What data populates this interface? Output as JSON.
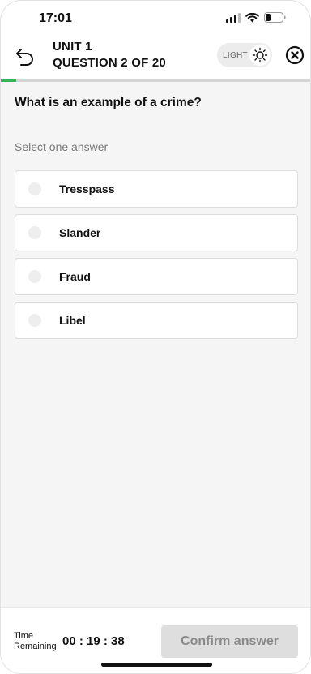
{
  "status": {
    "time": "17:01"
  },
  "header": {
    "unit": "UNIT 1",
    "question_count": "QUESTION 2 OF 20",
    "theme_label": "LIGHT"
  },
  "progress": {
    "fraction": 0.05
  },
  "question": {
    "text": "What is an example of a crime?",
    "instruction": "Select one answer",
    "options": [
      {
        "label": "Tresspass"
      },
      {
        "label": "Slander"
      },
      {
        "label": "Fraud"
      },
      {
        "label": "Libel"
      }
    ]
  },
  "footer": {
    "time_label": "Time Remaining",
    "timer": "00 : 19 : 38",
    "confirm_label": "Confirm answer"
  },
  "colors": {
    "progress": "#35b45a",
    "button_disabled": "#dedede"
  }
}
